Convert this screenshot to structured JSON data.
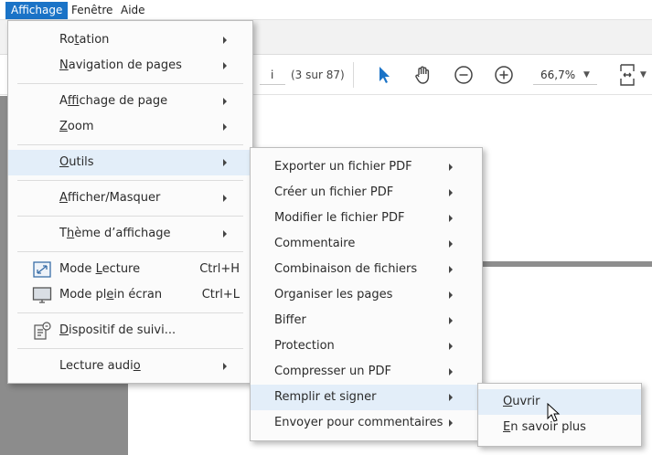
{
  "menubar": {
    "items": [
      {
        "label": "Affichage",
        "active": true
      },
      {
        "label": "Fenêtre",
        "active": false
      },
      {
        "label": "Aide",
        "active": false
      }
    ]
  },
  "toolbar": {
    "page_value": "i",
    "page_count": "(3 sur 87)",
    "zoom_value": "66,7%",
    "icons": [
      "select-arrow-icon",
      "hand-icon",
      "zoom-out-icon",
      "zoom-in-icon",
      "fit-page-icon"
    ],
    "accent": "#1a73c7"
  },
  "view_menu": {
    "items": [
      {
        "pre": "Ro",
        "key": "t",
        "post": "ation",
        "submenu": true
      },
      {
        "pre": "",
        "key": "N",
        "post": "avigation de pages",
        "submenu": true
      },
      {
        "pre": "A",
        "key": "f",
        "post": "fichage de page",
        "submenu": true
      },
      {
        "pre": "",
        "key": "Z",
        "post": "oom",
        "submenu": true
      },
      {
        "pre": "",
        "key": "O",
        "post": "utils",
        "submenu": true
      },
      {
        "pre": "",
        "key": "A",
        "post": "fficher/Masquer",
        "submenu": true
      },
      {
        "pre": "T",
        "key": "h",
        "post": "ème d’affichage",
        "submenu": true
      },
      {
        "pre": "Mode ",
        "key": "L",
        "post": "ecture",
        "shortcut": "Ctrl+H",
        "icon": "read-mode-icon"
      },
      {
        "pre": "Mode pl",
        "key": "e",
        "post": "in écran",
        "shortcut": "Ctrl+L",
        "icon": "fullscreen-icon"
      },
      {
        "pre": "",
        "key": "D",
        "post": "ispositif de suivi...",
        "icon": "tracker-icon"
      },
      {
        "pre": "Lecture audi",
        "key": "o",
        "post": "",
        "submenu": true
      }
    ]
  },
  "tools_menu": {
    "items": [
      {
        "label": "Exporter un fichier PDF"
      },
      {
        "label": "Créer un fichier PDF"
      },
      {
        "label": "Modifier le fichier PDF"
      },
      {
        "label": "Commentaire"
      },
      {
        "label": "Combinaison de fichiers"
      },
      {
        "label": "Organiser les pages"
      },
      {
        "label": "Biffer"
      },
      {
        "label": "Protection"
      },
      {
        "label": "Compresser un PDF"
      },
      {
        "label": "Remplir et signer"
      },
      {
        "label": "Envoyer pour commentaires"
      }
    ]
  },
  "fill_sign_menu": {
    "items": [
      {
        "key": "O",
        "post": "uvrir"
      },
      {
        "key": "E",
        "post": "n savoir plus"
      }
    ]
  },
  "colors": {
    "highlight": "#e3eef9",
    "menubar_active": "#1a73c7",
    "left_pane": "#8c8c8c"
  }
}
